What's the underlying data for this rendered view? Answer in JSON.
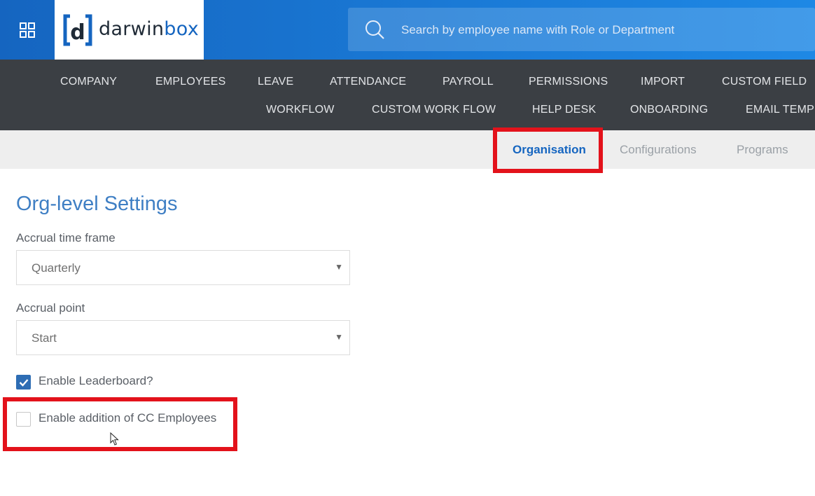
{
  "header": {
    "apps_icon": "apps-grid-icon",
    "logo": {
      "prefix": "darwin",
      "accent": "box",
      "mark_letter": "d"
    },
    "search": {
      "placeholder": "Search by employee name with Role or Department",
      "value": "",
      "icon": "search-icon"
    }
  },
  "nav": {
    "row1": [
      "COMPANY",
      "EMPLOYEES",
      "LEAVE",
      "ATTENDANCE",
      "PAYROLL",
      "PERMISSIONS",
      "IMPORT",
      "CUSTOM FIELD"
    ],
    "row2": [
      "WORKFLOW",
      "CUSTOM WORK FLOW",
      "HELP DESK",
      "ONBOARDING",
      "EMAIL TEMPL"
    ]
  },
  "subnav": {
    "tabs": [
      "Organisation",
      "Configurations",
      "Programs"
    ],
    "active": "Organisation"
  },
  "content": {
    "title": "Org-level Settings",
    "accrual_time_frame": {
      "label": "Accrual time frame",
      "value": "Quarterly"
    },
    "accrual_point": {
      "label": "Accrual point",
      "value": "Start"
    },
    "leaderboard": {
      "label": "Enable Leaderboard?",
      "checked": true
    },
    "cc_employees": {
      "label": "Enable addition of CC Employees",
      "checked": false
    }
  },
  "colors": {
    "header_blue": "#1976d2",
    "nav_bg": "#3b3f44",
    "subnav_bg": "#eeeeee",
    "accent": "#1565c0",
    "highlight_red": "#e3121b",
    "checkbox_blue": "#2e6db4"
  }
}
